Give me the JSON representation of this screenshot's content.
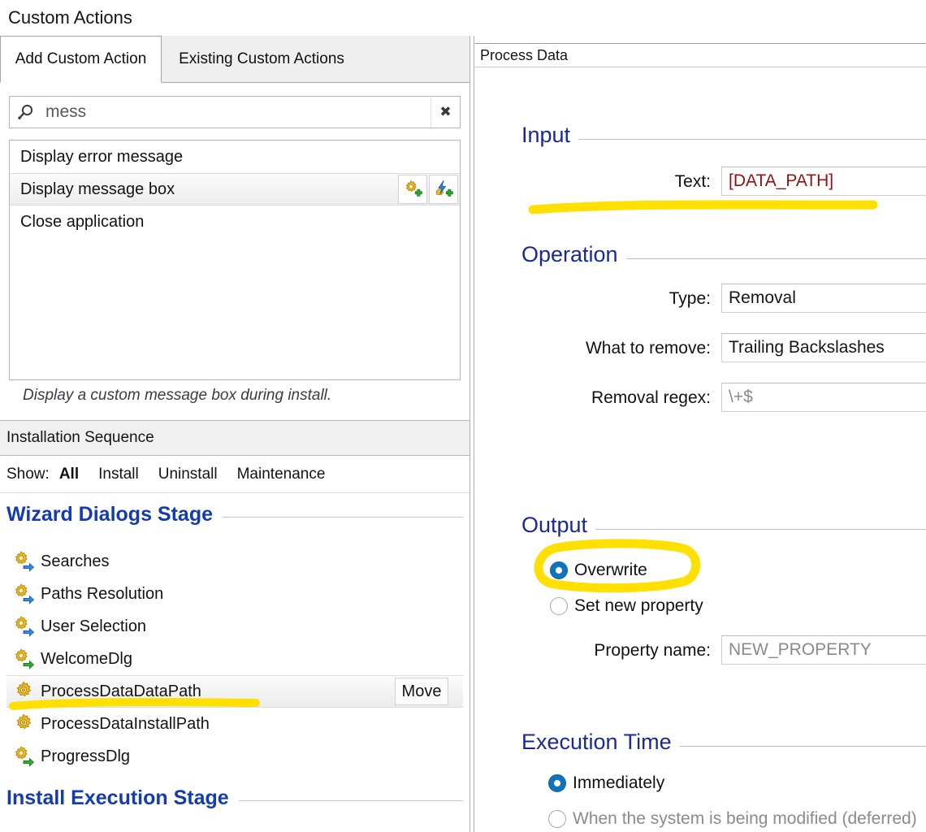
{
  "window": {
    "title": "Custom Actions"
  },
  "left": {
    "tabs": [
      {
        "label": "Add Custom Action",
        "active": true
      },
      {
        "label": "Existing Custom Actions",
        "active": false
      }
    ],
    "search": {
      "value": "mess",
      "placeholder": "Search",
      "icon": "search-icon",
      "clear_label": "✖"
    },
    "actions": [
      {
        "label": "Display error message",
        "selected": false
      },
      {
        "label": "Display message box",
        "selected": true
      },
      {
        "label": "Close application",
        "selected": false
      }
    ],
    "row_buttons": [
      {
        "name": "add-custom-action-gear-icon"
      },
      {
        "name": "add-custom-action-bolt-icon"
      }
    ],
    "hint": "Display a custom message box during install.",
    "sequence_panel_title": "Installation Sequence",
    "show": {
      "label": "Show:",
      "filters": [
        {
          "label": "All",
          "active": true
        },
        {
          "label": "Install",
          "active": false
        },
        {
          "label": "Uninstall",
          "active": false
        },
        {
          "label": "Maintenance",
          "active": false
        }
      ]
    },
    "stages": [
      {
        "title": "Wizard Dialogs Stage"
      },
      {
        "title": "Install Execution Stage"
      }
    ],
    "sequence_items": [
      {
        "label": "Searches",
        "icon": "gear-blue-arrow-icon",
        "selected": false
      },
      {
        "label": "Paths Resolution",
        "icon": "gear-blue-arrow-icon",
        "selected": false
      },
      {
        "label": "User Selection",
        "icon": "gear-blue-arrow-icon",
        "selected": false
      },
      {
        "label": "WelcomeDlg",
        "icon": "gear-green-arrow-icon",
        "selected": false
      },
      {
        "label": "ProcessDataDataPath",
        "icon": "gear-icon",
        "selected": true,
        "button": "Move"
      },
      {
        "label": "ProcessDataInstallPath",
        "icon": "gear-icon",
        "selected": false
      },
      {
        "label": "ProgressDlg",
        "icon": "gear-green-arrow-icon",
        "selected": false
      }
    ]
  },
  "right": {
    "panel_title": "Process Data",
    "groups": {
      "input": {
        "title": "Input",
        "fields": [
          {
            "label": "Text:",
            "value": "[DATA_PATH]",
            "style": "red"
          }
        ]
      },
      "operation": {
        "title": "Operation",
        "fields": [
          {
            "label": "Type:",
            "value": "Removal",
            "style": "normal"
          },
          {
            "label": "What to remove:",
            "value": "Trailing Backslashes",
            "style": "normal"
          },
          {
            "label": "Removal regex:",
            "value": "\\+$",
            "style": "muted"
          }
        ]
      },
      "output": {
        "title": "Output",
        "options": [
          {
            "label": "Overwrite",
            "selected": true,
            "disabled": false
          },
          {
            "label": "Set new property",
            "selected": false,
            "disabled": false
          }
        ],
        "fields": [
          {
            "label": "Property name:",
            "value": "NEW_PROPERTY",
            "style": "muted"
          }
        ]
      },
      "execution_time": {
        "title": "Execution Time",
        "options": [
          {
            "label": "Immediately",
            "selected": true,
            "disabled": false
          },
          {
            "label": "When the system is being modified (deferred)",
            "selected": false,
            "disabled": true
          }
        ]
      }
    }
  },
  "annotations": {
    "highlight_color": "#FFE000",
    "marks": [
      {
        "name": "underline-text-field",
        "kind": "underline"
      },
      {
        "name": "circle-overwrite-option",
        "kind": "circle"
      },
      {
        "name": "underline-processdatadatapath-item",
        "kind": "underline"
      }
    ]
  }
}
